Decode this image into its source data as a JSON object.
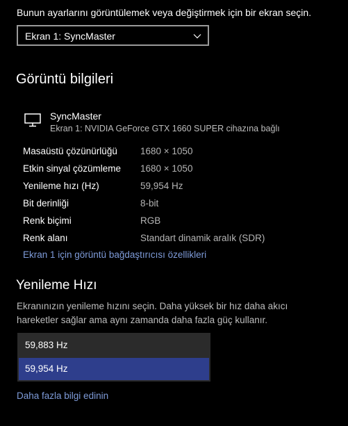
{
  "intro_text": "Bunun ayarlarını görüntülemek veya değiştirmek için bir ekran seçin.",
  "display_select": {
    "value": "Ekran 1: SyncMaster"
  },
  "display_info": {
    "title": "Görüntü bilgileri",
    "monitor_name": "SyncMaster",
    "monitor_subtitle": "Ekran 1: NVIDIA GeForce GTX 1660 SUPER cihazına bağlı",
    "rows": [
      {
        "label": "Masaüstü çözünürlüğü",
        "value": "1680 × 1050"
      },
      {
        "label": "Etkin sinyal çözümleme",
        "value": "1680 × 1050"
      },
      {
        "label": "Yenileme hızı (Hz)",
        "value": "59,954 Hz"
      },
      {
        "label": "Bit derinliği",
        "value": "8-bit"
      },
      {
        "label": "Renk biçimi",
        "value": "RGB"
      },
      {
        "label": "Renk alanı",
        "value": "Standart dinamik aralık (SDR)"
      }
    ],
    "adapter_link": "Ekran 1 için görüntü bağdaştırıcısı özellikleri"
  },
  "refresh_rate": {
    "title": "Yenileme Hızı",
    "description": "Ekranınızın yenileme hızını seçin. Daha yüksek bir hız daha akıcı hareketler sağlar ama aynı zamanda daha fazla güç kullanır.",
    "options": [
      "59,883 Hz",
      "59,954 Hz"
    ],
    "selected": "59,954 Hz",
    "learn_more_link": "Daha fazla bilgi edinin"
  },
  "colors": {
    "background": "#000000",
    "accent": "#2e3e8c",
    "link": "#7e9bd9",
    "secondary_text": "#b5b5b5",
    "dropdown_bg": "#2b2b2b"
  },
  "icons": {
    "monitor": "monitor-icon",
    "chevron": "chevron-down-icon"
  }
}
